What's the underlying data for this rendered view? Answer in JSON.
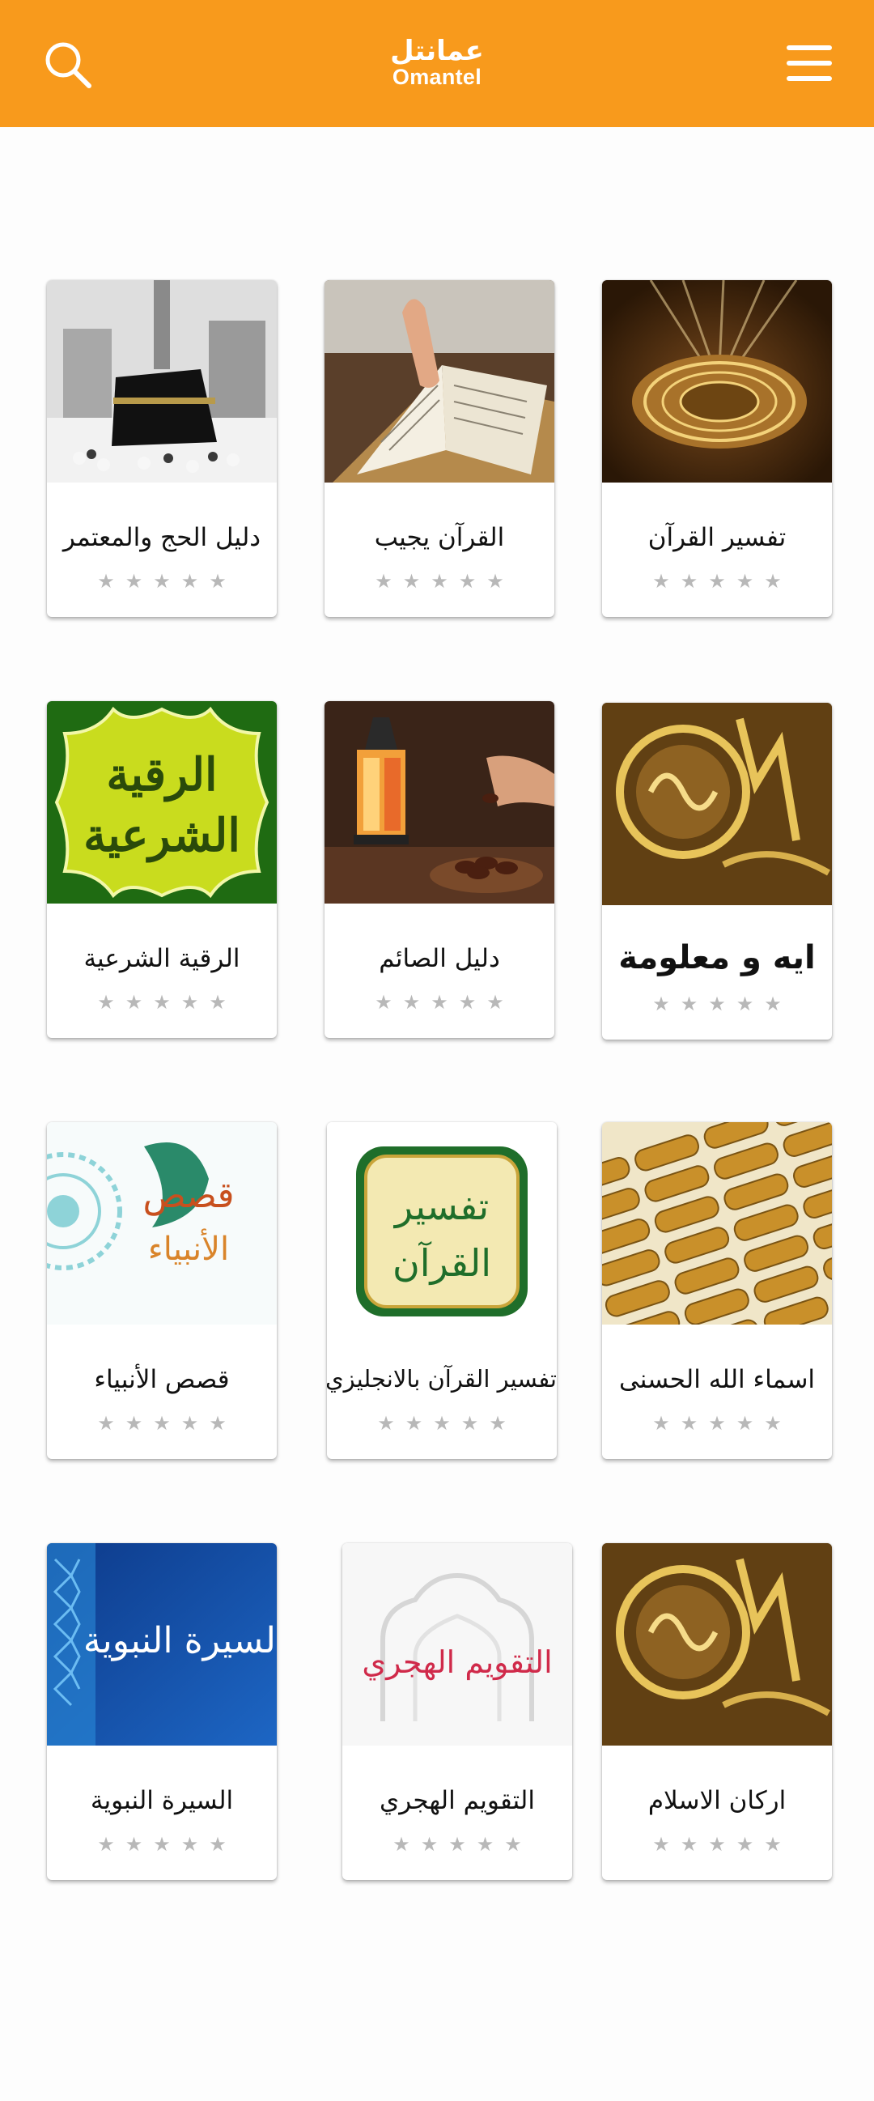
{
  "header": {
    "logo_ar": "عمانتل",
    "logo_en": "Omantel",
    "accent_color": "#f89a1c",
    "search_icon": "search-icon",
    "menu_icon": "hamburger-menu-icon"
  },
  "apps": [
    {
      "title": "تفسير القرآن",
      "rating": 0,
      "rating_stars": "★★★★★"
    },
    {
      "title": "القرآن يجيب",
      "rating": 0,
      "rating_stars": "★★★★★"
    },
    {
      "title": "دليل الحج والمعتمر",
      "rating": 0,
      "rating_stars": "★★★★★"
    },
    {
      "title": "ايه و معلومة",
      "rating": 0,
      "rating_stars": "★★★★★"
    },
    {
      "title": "دليل الصائم",
      "rating": 0,
      "rating_stars": "★★★★★"
    },
    {
      "title": "الرقية الشرعية",
      "rating": 0,
      "rating_stars": "★★★★★",
      "image_text_1": "الرقية",
      "image_text_2": "الشرعية"
    },
    {
      "title": "اسماء الله الحسنى",
      "rating": 0,
      "rating_stars": "★★★★★"
    },
    {
      "title": "تفسير القرآن بالانجليزي",
      "rating": 0,
      "rating_stars": "★★★★★",
      "image_text_1": "تفسير",
      "image_text_2": "القرآن"
    },
    {
      "title": "قصص الأنبياء",
      "rating": 0,
      "rating_stars": "★★★★★",
      "image_text_1": "قصص",
      "image_text_2": "الأنبياء"
    },
    {
      "title": "اركان الاسلام",
      "rating": 0,
      "rating_stars": "★★★★★"
    },
    {
      "title": "التقويم الهجري",
      "rating": 0,
      "rating_stars": "★★★★★",
      "image_text_1": "التقويم الهجري"
    },
    {
      "title": "السيرة النبوية",
      "rating": 0,
      "rating_stars": "★★★★★",
      "image_text_1": "السيرة النبوية"
    }
  ]
}
